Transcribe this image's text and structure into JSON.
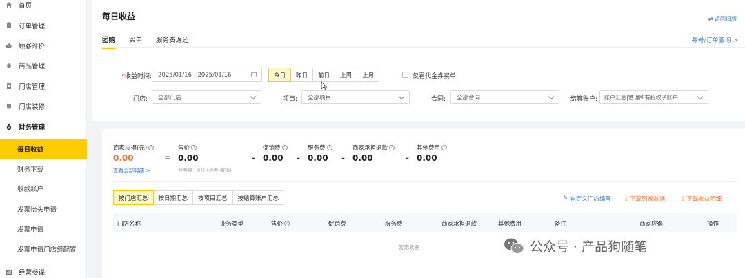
{
  "sidebar": {
    "items": [
      {
        "label": "首页",
        "icon": "home-icon"
      },
      {
        "label": "订单管理",
        "icon": "orders-icon"
      },
      {
        "label": "顾客评价",
        "icon": "thumbs-up-icon"
      },
      {
        "label": "商品管理",
        "icon": "goods-icon"
      },
      {
        "label": "门店管理",
        "icon": "store-icon"
      },
      {
        "label": "门店装修",
        "icon": "decoration-icon"
      },
      {
        "label": "财务管理",
        "icon": "money-bag-icon"
      }
    ],
    "sub_items": [
      {
        "label": "每日收益",
        "active": true
      },
      {
        "label": "财务下载"
      },
      {
        "label": "收款账户"
      },
      {
        "label": "发票抬头申请"
      },
      {
        "label": "发票申请"
      },
      {
        "label": "发票申请门店组配置"
      }
    ],
    "bottom_item": {
      "label": "经营参谋",
      "icon": "chart-icon"
    }
  },
  "header": {
    "title": "每日收益",
    "old_version_link": "返回旧版",
    "tabs": [
      "团购",
      "买单",
      "服务费返还"
    ],
    "order_link": "券号/订单查询 >"
  },
  "filters": {
    "date_label": "收益时间:",
    "date_range": "2025/01/16 - 2025/01/16",
    "date_buttons": [
      "今日",
      "昨日",
      "前日",
      "上周",
      "上月"
    ],
    "proxy_checkbox_label": "仅看代金券买单",
    "store_label": "门店:",
    "store_value": "全部门店",
    "project_label": "项目:",
    "project_value": "全部项目",
    "contract_label": "合同:",
    "contract_value": "全部合同",
    "account_label": "结算账户:",
    "account_value": "账户汇总|管理所有授权子账户"
  },
  "stats": {
    "receivable_title": "商家应得(元)",
    "receivable_value": "0.00",
    "eq": "=",
    "price_title": "售价",
    "price_value": "0.00",
    "promo_title": "促销费",
    "promo_value": "0.00",
    "service_title": "服务费",
    "service_value": "0.00",
    "refund_title": "商家承担退款",
    "refund_value": "0.00",
    "other_title": "其他费用",
    "other_value": "0.00",
    "minus": "-",
    "detail_link": "查看全部明细 >",
    "verify_text": "验券量：0张 (验券-撤销)"
  },
  "summary": {
    "buttons": [
      "按门店汇总",
      "按日期汇总",
      "按项目汇总",
      "按结算账户汇总"
    ],
    "custom_store_no": "自定义门店编号",
    "download_list": "下载列表数据",
    "download_detail": "下载收益明细"
  },
  "table": {
    "columns": [
      "门店名称",
      "业务类型",
      "售价",
      "促销费",
      "服务费",
      "商家承担退款",
      "其他费用",
      "备注",
      "商家应得",
      "操作"
    ],
    "empty_text": "暂无数据"
  },
  "watermark": {
    "text": "公众号 · 产品狗随笔"
  },
  "colors": {
    "accent": "#ffcc00",
    "link": "#3a7bd5",
    "orange": "#f5722d"
  }
}
